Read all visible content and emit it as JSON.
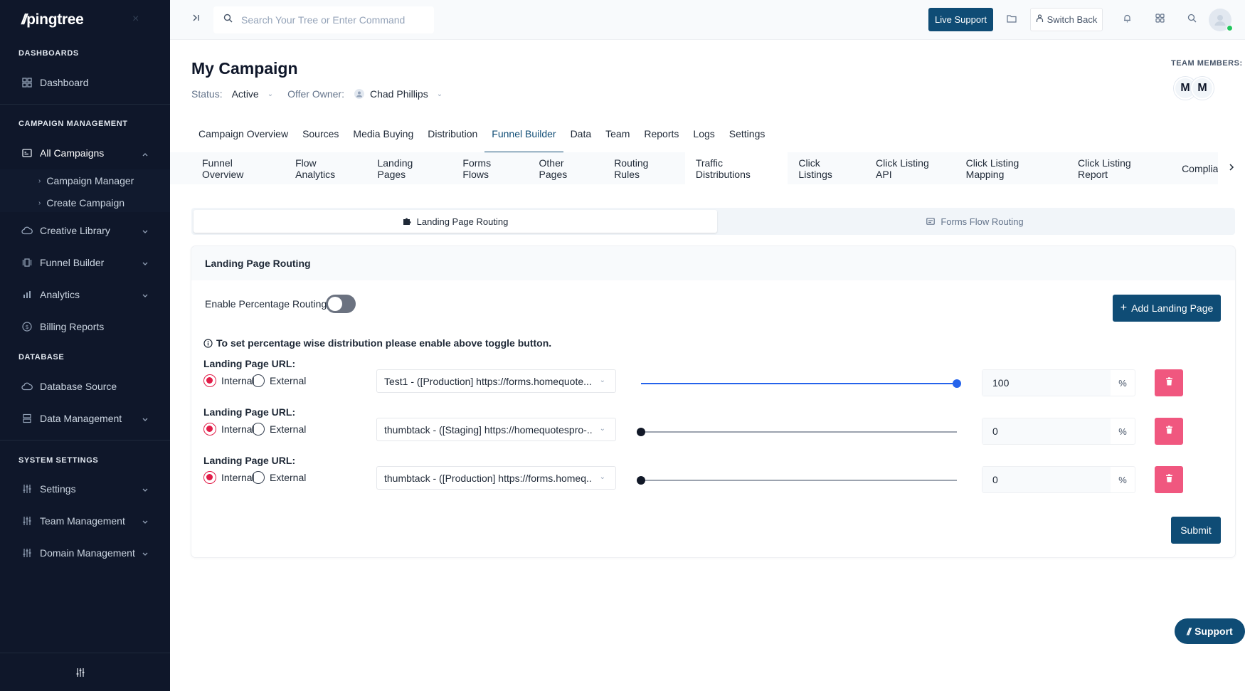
{
  "brand": {
    "mark": "//",
    "name": "pingtree"
  },
  "sidebar": {
    "sections": {
      "dashboards": "DASHBOARDS",
      "campaign_management": "CAMPAIGN MANAGEMENT",
      "database": "DATABASE",
      "system_settings": "SYSTEM SETTINGS"
    },
    "items": {
      "dashboard": "Dashboard",
      "all_campaigns": "All Campaigns",
      "campaign_manager": "Campaign Manager",
      "create_campaign": "Create Campaign",
      "creative_library": "Creative Library",
      "funnel_builder": "Funnel Builder",
      "analytics": "Analytics",
      "billing_reports": "Billing Reports",
      "database_source": "Database Source",
      "data_management": "Data Management",
      "settings": "Settings",
      "team_management": "Team Management",
      "domain_management": "Domain Management"
    }
  },
  "topbar": {
    "search_placeholder": "Search Your Tree or Enter Command",
    "live_support": "Live Support",
    "switch_back": "Switch Back"
  },
  "page": {
    "title": "My Campaign",
    "status_label": "Status:",
    "status_value": "Active",
    "owner_label": "Offer Owner:",
    "owner_value": "Chad Phillips",
    "team_members_label": "TEAM MEMBERS:",
    "team_members": [
      "M",
      "M"
    ]
  },
  "tabs_primary": [
    "Campaign Overview",
    "Sources",
    "Media Buying",
    "Distribution",
    "Funnel Builder",
    "Data",
    "Team",
    "Reports",
    "Logs",
    "Settings"
  ],
  "tabs_primary_active": "Funnel Builder",
  "tabs_secondary": [
    "Funnel Overview",
    "Flow Analytics",
    "Landing Pages",
    "Forms Flows",
    "Other Pages",
    "Routing Rules",
    "Traffic Distributions",
    "Click Listings",
    "Click Listing API",
    "Click Listing Mapping",
    "Click Listing Report",
    "Compliance"
  ],
  "tabs_secondary_active": "Traffic Distributions",
  "routing_switch": {
    "landing": "Landing Page Routing",
    "forms": "Forms Flow Routing"
  },
  "card": {
    "title": "Landing Page Routing",
    "enable_label": "Enable Percentage Routing",
    "enable_on": false,
    "add_button": "Add Landing Page",
    "info": "To set percentage wise distribution please enable above toggle button.",
    "url_label": "Landing Page URL:",
    "internal_label": "Internal",
    "external_label": "External",
    "unit": "%",
    "submit": "Submit",
    "rows": [
      {
        "type": "Internal",
        "page": "Test1 - ([Production] https://forms.homequote...",
        "percent": "100"
      },
      {
        "type": "Internal",
        "page": "thumbtack - ([Staging] https://homequotespro-...",
        "percent": "0"
      },
      {
        "type": "Internal",
        "page": "thumbtack - ([Production] https://forms.homeq...",
        "percent": "0"
      }
    ]
  },
  "support_button": "Support",
  "colors": {
    "sidebar_bg": "#0f172a",
    "primary": "#0f4c75",
    "danger": "#f0577f",
    "radio_active": "#e11d48",
    "slider_active": "#2563eb"
  }
}
